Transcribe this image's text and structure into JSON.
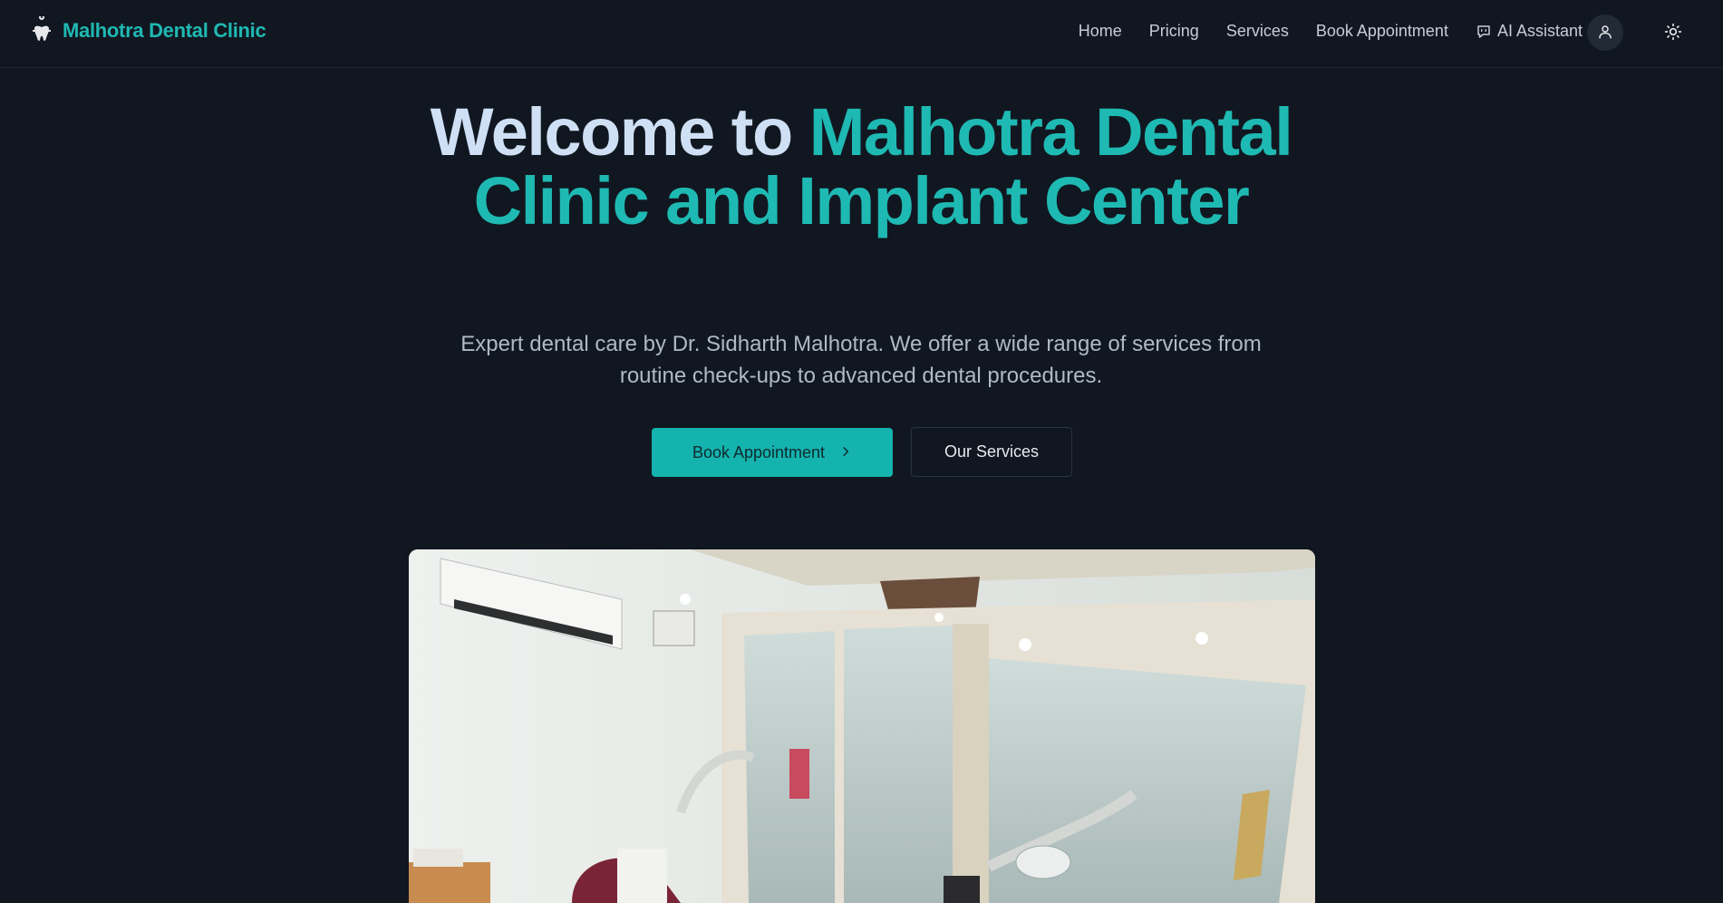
{
  "navbar": {
    "brand_name": "Malhotra Dental Clinic",
    "brand_icon": "tooth-icon",
    "links": [
      {
        "label": "Home"
      },
      {
        "label": "Pricing"
      },
      {
        "label": "Services"
      },
      {
        "label": "Book Appointment"
      },
      {
        "label": "AI Assistant",
        "icon": "chat-icon"
      }
    ],
    "user_icon": "user-icon",
    "theme_icon": "sun-icon"
  },
  "hero": {
    "title_lead": "Welcome to",
    "title_accent": "Malhotra Dental Clinic and Implant Center",
    "subtitle": "Expert dental care by Dr. Sidharth Malhotra. We offer a wide range of services from routine check-ups to advanced dental procedures.",
    "primary_button_label": "Book Appointment",
    "primary_button_icon": "chevron-right-icon",
    "secondary_button_label": "Our Services",
    "image_description_icon": "clinic-photo"
  },
  "colors": {
    "background": "#111720",
    "accent": "#1fb9b3",
    "button_primary": "#14b3ae",
    "heading_light": "#cfe0f5",
    "body_text": "#b0b9c6"
  }
}
